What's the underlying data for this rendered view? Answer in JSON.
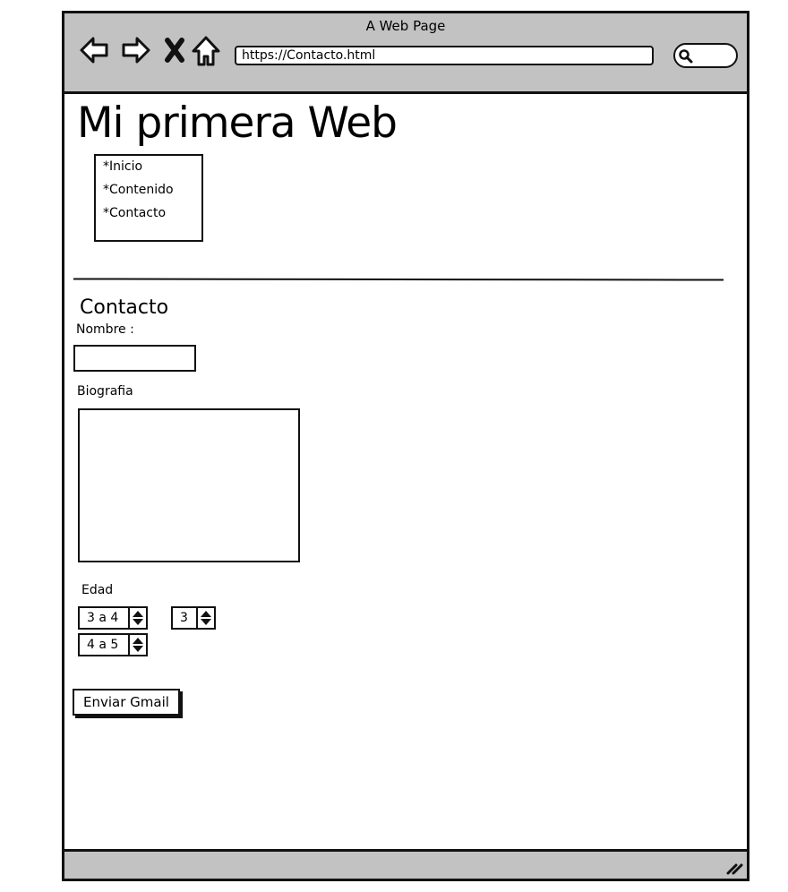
{
  "window": {
    "title": "A Web Page",
    "url": "https://Contacto.html"
  },
  "page": {
    "heading": "Mi primera Web"
  },
  "nav": {
    "items": [
      "*Inicio",
      "*Contenido",
      "*Contacto"
    ]
  },
  "contact": {
    "title": "Contacto",
    "name_label": "Nombre :",
    "bio_label": "Biografia",
    "age_label": "Edad",
    "age_steppers": [
      "3 a 4",
      "3",
      "4 a 5"
    ],
    "send_label": "Enviar Gmail"
  }
}
